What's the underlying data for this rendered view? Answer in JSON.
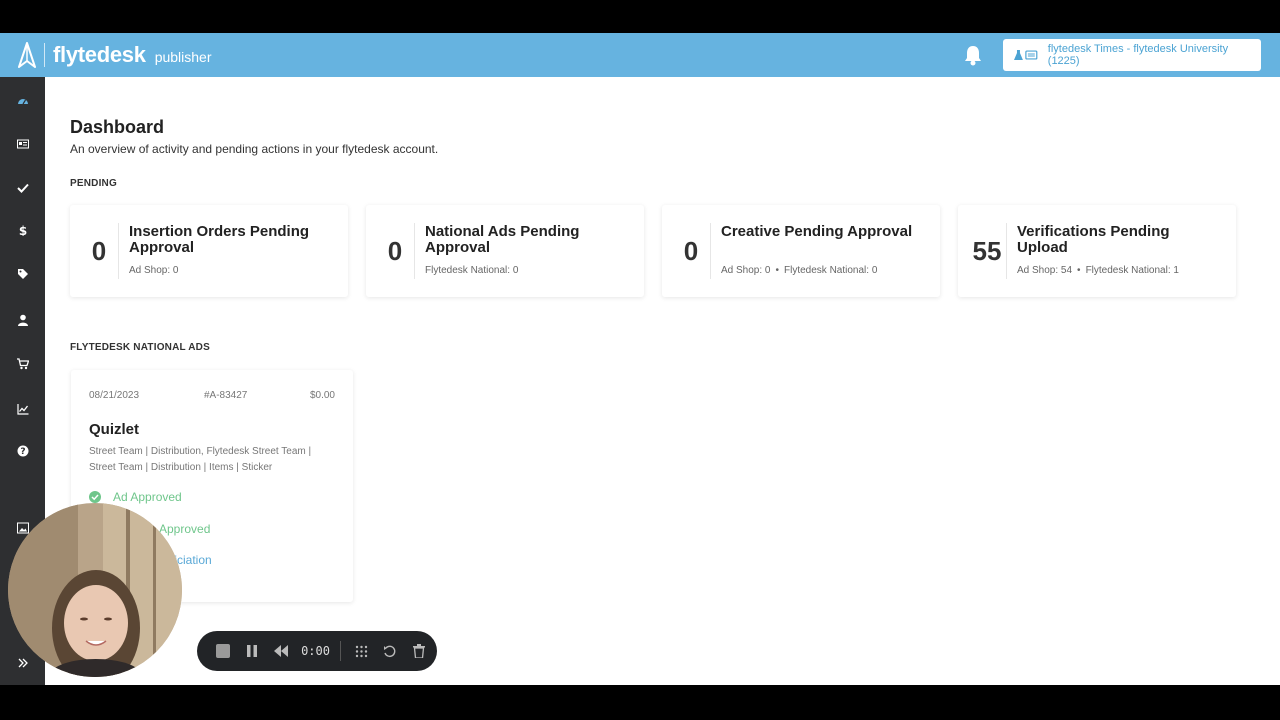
{
  "header": {
    "brand": "flytedesk",
    "brand_sub": "publisher",
    "account_label": "flytedesk Times - flytedesk University (1225)"
  },
  "sidebar": {
    "items": [
      "dashboard-icon",
      "newspaper-icon",
      "check-icon",
      "dollar-icon",
      "tag-icon",
      "user-icon",
      "cart-icon",
      "chart-line-icon",
      "help-icon",
      "image-icon",
      "expand-icon"
    ]
  },
  "main": {
    "title": "Dashboard",
    "subtitle": "An overview of activity and pending actions in your flytedesk account.",
    "pending_label": "PENDING",
    "national_label": "FLYTEDESK NATIONAL ADS"
  },
  "pending_cards": [
    {
      "count": "0",
      "title": "Insertion Orders Pending Approval",
      "meta_a": "Ad Shop: 0",
      "meta_b": ""
    },
    {
      "count": "0",
      "title": "National Ads Pending Approval",
      "meta_a": "Flytedesk National: 0",
      "meta_b": ""
    },
    {
      "count": "0",
      "title": "Creative Pending Approval",
      "meta_a": "Ad Shop: 0",
      "meta_b": "Flytedesk National: 0"
    },
    {
      "count": "55",
      "title": "Verifications Pending Upload",
      "meta_a": "Ad Shop: 54",
      "meta_b": "Flytedesk National: 1"
    }
  ],
  "ad": {
    "date": "08/21/2023",
    "id": "#A-83427",
    "price": "$0.00",
    "name": "Quizlet",
    "description": "Street Team | Distribution, Flytedesk Street Team | Street Team | Distribution | Items | Sticker",
    "status_1": "Ad Approved",
    "status_2": "Approved",
    "status_3": "ficiation"
  },
  "recorder": {
    "time": "0:00"
  },
  "colors": {
    "header": "#66b3e0",
    "sidebar": "#2e2f31",
    "success": "#6fc68b",
    "link": "#59a8d6"
  }
}
